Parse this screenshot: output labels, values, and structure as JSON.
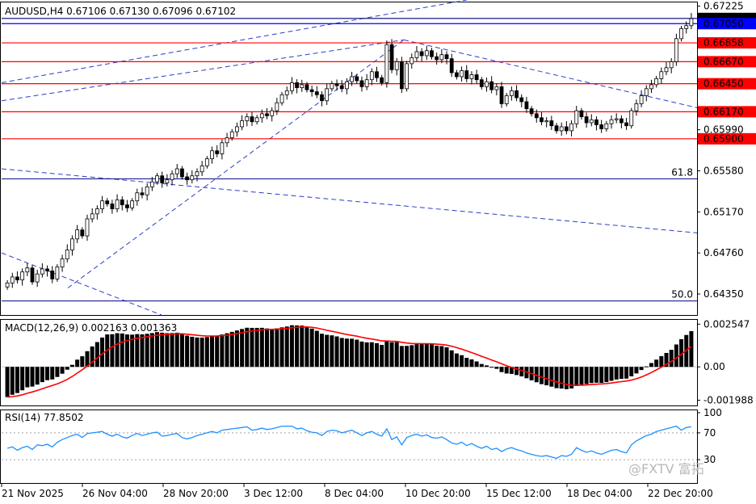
{
  "chart_data": {
    "type": "candlestick",
    "symbol_header": "AUDUSD,H4  0.67106 0.67130 0.67096 0.67102",
    "price_axis": {
      "ylim": [
        0.6414,
        0.6727
      ],
      "ticks": [
        "0.67225",
        "0.67102",
        "0.67050",
        "0.66858",
        "0.66670",
        "0.66450",
        "0.66170",
        "0.65990",
        "0.65900",
        "0.65580",
        "0.65170",
        "0.64760",
        "0.64350"
      ],
      "tick_values": [
        0.67225,
        0.67102,
        0.6705,
        0.66858,
        0.6667,
        0.6645,
        0.6617,
        0.6599,
        0.659,
        0.6558,
        0.6517,
        0.6476,
        0.6435
      ],
      "boxed": [
        {
          "label": "0.67102",
          "bg": "#000000",
          "fg": "#ffffff"
        },
        {
          "label": "0.67050",
          "bg": "#0000ff",
          "fg": "#ffffff"
        },
        {
          "label": "0.66858",
          "bg": "#ff0000",
          "fg": "#ffffff"
        },
        {
          "label": "0.66670",
          "bg": "#ff0000",
          "fg": "#ffffff"
        },
        {
          "label": "0.66450",
          "bg": "#ff0000",
          "fg": "#ffffff"
        },
        {
          "label": "0.66170",
          "bg": "#ff0000",
          "fg": "#ffffff"
        },
        {
          "label": "0.65900",
          "bg": "#ff0000",
          "fg": "#ffffff"
        }
      ]
    },
    "horizontal_levels": [
      {
        "value": 0.66858,
        "color": "#ff0000"
      },
      {
        "value": 0.6667,
        "color": "#ff0000"
      },
      {
        "value": 0.6645,
        "color": "#ff0000"
      },
      {
        "value": 0.6617,
        "color": "#ff0000"
      },
      {
        "value": 0.659,
        "color": "#ff0000"
      },
      {
        "value": 0.6705,
        "color": "#0000ff"
      },
      {
        "value": 0.67102,
        "color": "#000080"
      }
    ],
    "fib_levels": [
      {
        "label": "61.8",
        "value": 0.655
      },
      {
        "label": "50.0",
        "value": 0.6428
      }
    ],
    "x_labels": [
      "21 Nov 2025",
      "26 Nov 04:00",
      "28 Nov 20:00",
      "3 Dec 12:00",
      "8 Dec 04:00",
      "10 Dec 20:00",
      "15 Dec 12:00",
      "18 Dec 04:00",
      "22 Dec 20:00"
    ],
    "close": [
      0.6446,
      0.6452,
      0.6449,
      0.6457,
      0.6461,
      0.6447,
      0.6455,
      0.646,
      0.6458,
      0.645,
      0.6462,
      0.647,
      0.6479,
      0.649,
      0.6499,
      0.6493,
      0.651,
      0.6515,
      0.652,
      0.6528,
      0.6525,
      0.652,
      0.6529,
      0.6524,
      0.6521,
      0.6528,
      0.6536,
      0.6534,
      0.6542,
      0.6547,
      0.6553,
      0.6546,
      0.6549,
      0.6555,
      0.656,
      0.6552,
      0.6549,
      0.6553,
      0.6557,
      0.6563,
      0.657,
      0.6578,
      0.6575,
      0.6586,
      0.6591,
      0.6597,
      0.6602,
      0.6608,
      0.6612,
      0.6607,
      0.6611,
      0.6615,
      0.6613,
      0.6618,
      0.6626,
      0.6634,
      0.6638,
      0.6646,
      0.6641,
      0.6644,
      0.6639,
      0.6637,
      0.6634,
      0.6628,
      0.664,
      0.6645,
      0.6643,
      0.664,
      0.6647,
      0.6652,
      0.6648,
      0.6642,
      0.6649,
      0.6657,
      0.6651,
      0.6646,
      0.6684,
      0.6659,
      0.6667,
      0.664,
      0.6665,
      0.6671,
      0.6677,
      0.6673,
      0.6678,
      0.6672,
      0.6669,
      0.6674,
      0.667,
      0.6656,
      0.6652,
      0.6658,
      0.665,
      0.6654,
      0.6649,
      0.6642,
      0.6647,
      0.6639,
      0.6642,
      0.6625,
      0.6633,
      0.6638,
      0.6631,
      0.6627,
      0.662,
      0.6615,
      0.6611,
      0.6607,
      0.6608,
      0.6603,
      0.6598,
      0.6602,
      0.6598,
      0.6605,
      0.6618,
      0.6612,
      0.6606,
      0.6609,
      0.6604,
      0.66,
      0.6605,
      0.6609,
      0.661,
      0.6606,
      0.6603,
      0.6618,
      0.6625,
      0.6633,
      0.664,
      0.6644,
      0.665,
      0.6657,
      0.6661,
      0.6667,
      0.669,
      0.67,
      0.6703,
      0.671
    ],
    "macd": {
      "label": "MACD(12,26,9) 0.002163 0.001363",
      "ylim": [
        -0.0023,
        0.00285
      ],
      "ticks": [
        "0.002547",
        "0.00",
        "-0.001988"
      ],
      "tick_values": [
        0.002547,
        0.0,
        -0.001988
      ],
      "hist_color": "#000000",
      "signal_color": "#ff0000"
    },
    "rsi": {
      "label": "RSI(14) 77.8502",
      "ylim": [
        0,
        100
      ],
      "ticks": [
        "100",
        "70",
        "30"
      ],
      "tick_values": [
        100,
        70,
        30
      ],
      "levels": [
        70,
        30
      ],
      "line_color": "#1e90ff",
      "values": [
        47,
        49,
        44,
        48,
        50,
        45,
        52,
        51,
        53,
        49,
        56,
        60,
        63,
        66,
        68,
        63,
        69,
        70,
        71,
        72,
        68,
        65,
        68,
        64,
        62,
        66,
        69,
        66,
        68,
        70,
        71,
        65,
        66,
        68,
        69,
        63,
        61,
        63,
        66,
        68,
        70,
        72,
        70,
        74,
        75,
        76,
        77,
        78,
        79,
        74,
        75,
        77,
        75,
        76,
        78,
        80,
        80,
        80,
        76,
        77,
        73,
        71,
        70,
        66,
        72,
        74,
        73,
        70,
        72,
        74,
        70,
        66,
        70,
        72,
        68,
        65,
        76,
        60,
        64,
        52,
        63,
        66,
        68,
        65,
        67,
        63,
        62,
        64,
        60,
        55,
        53,
        56,
        51,
        54,
        50,
        47,
        50,
        45,
        47,
        42,
        46,
        48,
        45,
        43,
        40,
        38,
        36,
        35,
        36,
        34,
        32,
        36,
        35,
        38,
        48,
        44,
        41,
        43,
        40,
        38,
        41,
        44,
        45,
        42,
        40,
        52,
        58,
        62,
        66,
        68,
        72,
        74,
        76,
        78,
        80,
        74,
        78,
        79
      ]
    },
    "watermark": "@FXTV 富拓"
  }
}
